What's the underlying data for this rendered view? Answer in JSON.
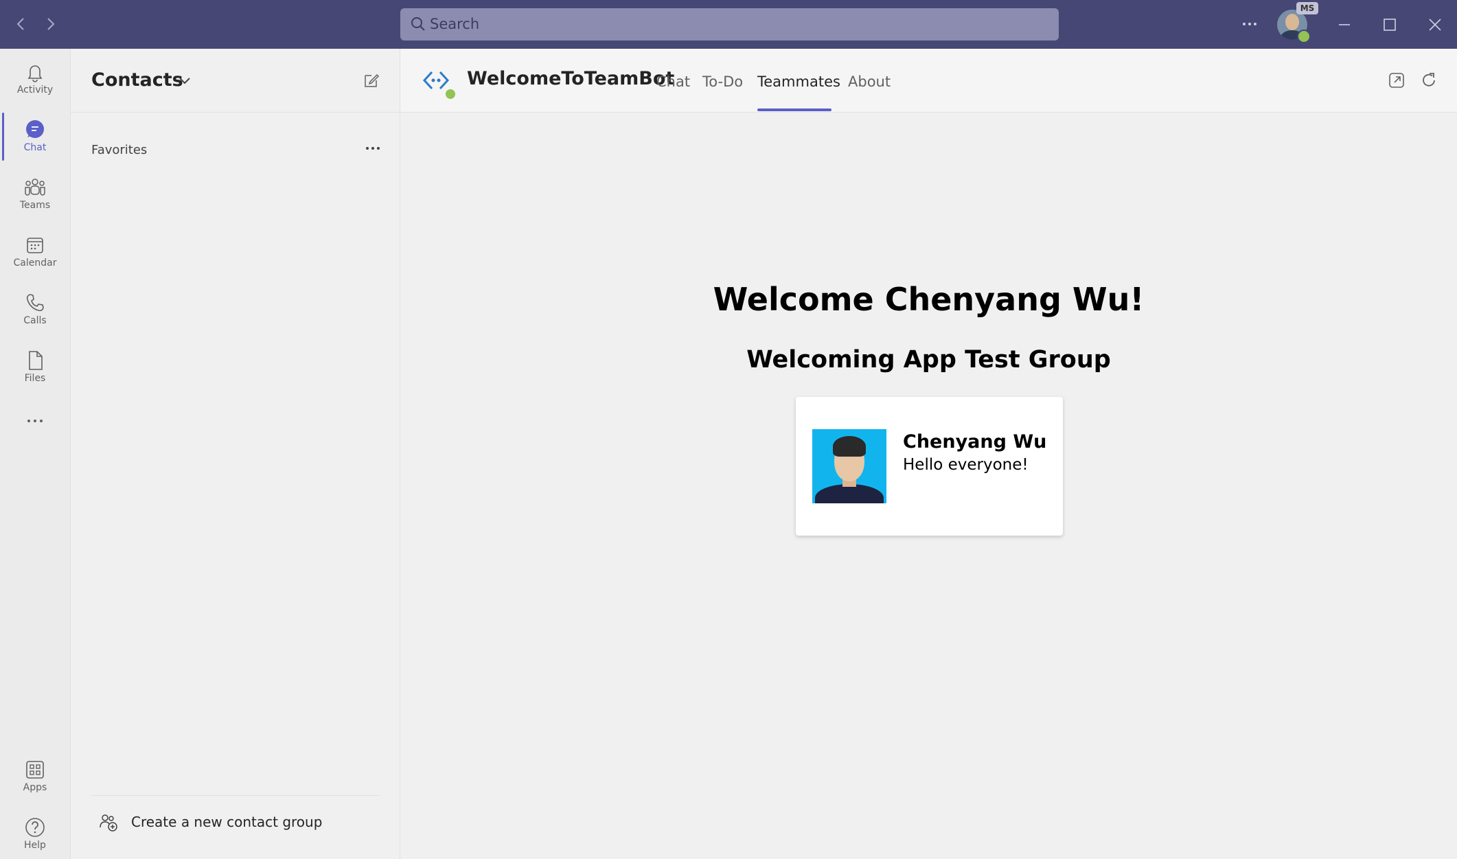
{
  "titlebar": {
    "search_placeholder": "Search",
    "badge": "MS"
  },
  "rail": {
    "items": [
      {
        "label": "Activity",
        "icon": "bell-icon"
      },
      {
        "label": "Chat",
        "icon": "chat-icon",
        "active": true
      },
      {
        "label": "Teams",
        "icon": "teams-icon"
      },
      {
        "label": "Calendar",
        "icon": "calendar-icon"
      },
      {
        "label": "Calls",
        "icon": "phone-icon"
      },
      {
        "label": "Files",
        "icon": "file-icon"
      }
    ],
    "bottom": [
      {
        "label": "Apps",
        "icon": "apps-icon"
      },
      {
        "label": "Help",
        "icon": "help-icon"
      }
    ]
  },
  "pane": {
    "title": "Contacts",
    "favorites_label": "Favorites",
    "create_group_label": "Create a new contact group"
  },
  "main": {
    "bot_name": "WelcomeToTeamBot",
    "tabs": [
      {
        "label": "Chat"
      },
      {
        "label": "To-Do"
      },
      {
        "label": "Teammates",
        "active": true
      },
      {
        "label": "About"
      }
    ],
    "welcome_title": "Welcome Chenyang Wu!",
    "group_title": "Welcoming App Test Group",
    "card": {
      "name": "Chenyang Wu",
      "message": "Hello everyone!"
    }
  },
  "colors": {
    "titlebar": "#464775",
    "accent": "#5b5fc7",
    "presence": "#92c353"
  }
}
